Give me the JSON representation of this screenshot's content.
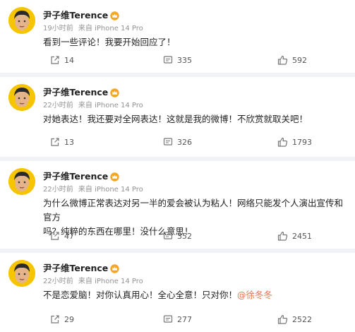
{
  "posts": [
    {
      "author": "尹子维Terence",
      "time": "19小时前",
      "source": "来自 iPhone 14 Pro",
      "text": "看到一些评论！我要开始回应了！",
      "mention": "",
      "reposts": "14",
      "comments": "335",
      "likes": "592"
    },
    {
      "author": "尹子维Terence",
      "time": "22小时前",
      "source": "来自 iPhone 14 Pro",
      "text": "对她表达！我还要对全网表达！这就是我的微博！不欣赏就取关吧！",
      "mention": "",
      "reposts": "13",
      "comments": "326",
      "likes": "1793"
    },
    {
      "author": "尹子维Terence",
      "time": "22小时前",
      "source": "来自 iPhone 14 Pro",
      "text_line1": "为什么微博正常表达对另一半的爱会被认为粘人！网络只能发个人演出宣传和官方",
      "text_line2": "吗？纯粹的东西在哪里！没什么意思！",
      "mention": "",
      "reposts": "47",
      "comments": "352",
      "likes": "2451"
    },
    {
      "author": "尹子维Terence",
      "time": "22小时前",
      "source": "来自 iPhone 14 Pro",
      "text": "不是恋爱脑！对你认真用心！全心全意！只对你！",
      "mention": "@徐冬冬",
      "reposts": "29",
      "comments": "277",
      "likes": "2522"
    }
  ],
  "icons": {
    "verified": "crown-badge-icon",
    "repost": "repost-icon",
    "comment": "comment-icon",
    "like": "thumbs-up-icon"
  },
  "colors": {
    "background": "#f1f2f5",
    "card": "#ffffff",
    "text": "#222222",
    "meta": "#939393",
    "mention": "#eb7350",
    "badge": "#f5a623"
  }
}
